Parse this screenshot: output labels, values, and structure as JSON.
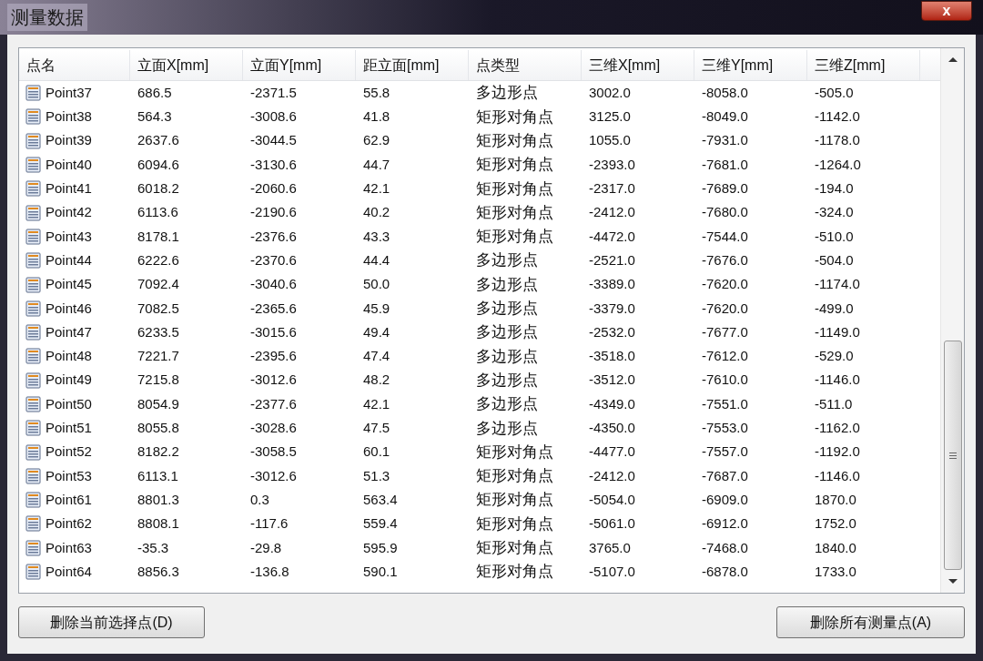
{
  "window": {
    "title": "测量数据",
    "close_label": "x"
  },
  "table": {
    "columns": [
      "点名",
      "立面X[mm]",
      "立面Y[mm]",
      "距立面[mm]",
      "点类型",
      "三维X[mm]",
      "三维Y[mm]",
      "三维Z[mm]"
    ],
    "rows": [
      [
        "Point37",
        "686.5",
        "-2371.5",
        "55.8",
        "多边形点",
        "3002.0",
        "-8058.0",
        "-505.0"
      ],
      [
        "Point38",
        "564.3",
        "-3008.6",
        "41.8",
        "矩形对角点",
        "3125.0",
        "-8049.0",
        "-1142.0"
      ],
      [
        "Point39",
        "2637.6",
        "-3044.5",
        "62.9",
        "矩形对角点",
        "1055.0",
        "-7931.0",
        "-1178.0"
      ],
      [
        "Point40",
        "6094.6",
        "-3130.6",
        "44.7",
        "矩形对角点",
        "-2393.0",
        "-7681.0",
        "-1264.0"
      ],
      [
        "Point41",
        "6018.2",
        "-2060.6",
        "42.1",
        "矩形对角点",
        "-2317.0",
        "-7689.0",
        "-194.0"
      ],
      [
        "Point42",
        "6113.6",
        "-2190.6",
        "40.2",
        "矩形对角点",
        "-2412.0",
        "-7680.0",
        "-324.0"
      ],
      [
        "Point43",
        "8178.1",
        "-2376.6",
        "43.3",
        "矩形对角点",
        "-4472.0",
        "-7544.0",
        "-510.0"
      ],
      [
        "Point44",
        "6222.6",
        "-2370.6",
        "44.4",
        "多边形点",
        "-2521.0",
        "-7676.0",
        "-504.0"
      ],
      [
        "Point45",
        "7092.4",
        "-3040.6",
        "50.0",
        "多边形点",
        "-3389.0",
        "-7620.0",
        "-1174.0"
      ],
      [
        "Point46",
        "7082.5",
        "-2365.6",
        "45.9",
        "多边形点",
        "-3379.0",
        "-7620.0",
        "-499.0"
      ],
      [
        "Point47",
        "6233.5",
        "-3015.6",
        "49.4",
        "多边形点",
        "-2532.0",
        "-7677.0",
        "-1149.0"
      ],
      [
        "Point48",
        "7221.7",
        "-2395.6",
        "47.4",
        "多边形点",
        "-3518.0",
        "-7612.0",
        "-529.0"
      ],
      [
        "Point49",
        "7215.8",
        "-3012.6",
        "48.2",
        "多边形点",
        "-3512.0",
        "-7610.0",
        "-1146.0"
      ],
      [
        "Point50",
        "8054.9",
        "-2377.6",
        "42.1",
        "多边形点",
        "-4349.0",
        "-7551.0",
        "-511.0"
      ],
      [
        "Point51",
        "8055.8",
        "-3028.6",
        "47.5",
        "多边形点",
        "-4350.0",
        "-7553.0",
        "-1162.0"
      ],
      [
        "Point52",
        "8182.2",
        "-3058.5",
        "60.1",
        "矩形对角点",
        "-4477.0",
        "-7557.0",
        "-1192.0"
      ],
      [
        "Point53",
        "6113.1",
        "-3012.6",
        "51.3",
        "矩形对角点",
        "-2412.0",
        "-7687.0",
        "-1146.0"
      ],
      [
        "Point61",
        "8801.3",
        "0.3",
        "563.4",
        "矩形对角点",
        "-5054.0",
        "-6909.0",
        "1870.0"
      ],
      [
        "Point62",
        "8808.1",
        "-117.6",
        "559.4",
        "矩形对角点",
        "-5061.0",
        "-6912.0",
        "1752.0"
      ],
      [
        "Point63",
        "-35.3",
        "-29.8",
        "595.9",
        "矩形对角点",
        "3765.0",
        "-7468.0",
        "1840.0"
      ],
      [
        "Point64",
        "8856.3",
        "-136.8",
        "590.1",
        "矩形对角点",
        "-5107.0",
        "-6878.0",
        "1733.0"
      ]
    ]
  },
  "buttons": [
    "删除当前选择点(D)",
    "删除所有测量点(A)"
  ]
}
